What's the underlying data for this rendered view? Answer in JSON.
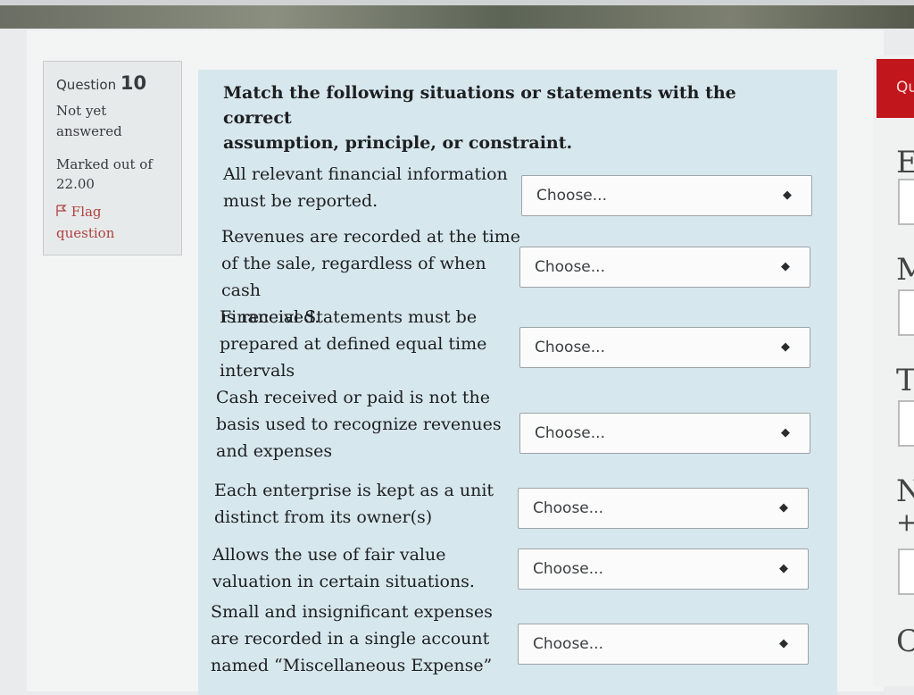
{
  "question": {
    "label": "Question",
    "number": "10",
    "state_line1": "Not yet",
    "state_line2": "answered",
    "grade_line1": "Marked out of",
    "grade_line2": "22.00",
    "flag_line1": "Flag",
    "flag_line2": "question",
    "text_line1": "Match the following situations or statements with the correct",
    "text_line2": "assumption, principle, or constraint."
  },
  "rows": [
    {
      "lines": [
        "All relevant financial information",
        "must be reported."
      ],
      "select": "Choose..."
    },
    {
      "lines": [
        "Revenues are recorded at the time",
        "of the sale, regardless of when cash",
        "is received."
      ],
      "select": "Choose..."
    },
    {
      "lines": [
        "Financial Statements must be",
        "prepared at defined equal time",
        "intervals"
      ],
      "select": "Choose..."
    },
    {
      "lines": [
        "Cash received or paid is not the",
        "basis used to recognize revenues",
        "and expenses"
      ],
      "select": "Choose..."
    },
    {
      "lines": [
        "Each enterprise is kept as a unit",
        "distinct from its owner(s)"
      ],
      "select": "Choose..."
    },
    {
      "lines": [
        "Allows the use of fair value",
        "valuation in certain situations."
      ],
      "select": "Choose..."
    },
    {
      "lines": [
        "Small and insignificant expenses",
        "are recorded in a single account",
        "named “Miscellaneous Expense”"
      ],
      "select": "Choose..."
    }
  ],
  "quiz_nav": {
    "tab_label": "Qu",
    "letters": [
      "E",
      "M",
      "T",
      "N",
      "+",
      "C"
    ]
  },
  "icons": {
    "select_arrows": "updown-arrows-icon",
    "flag": "flag-icon"
  }
}
